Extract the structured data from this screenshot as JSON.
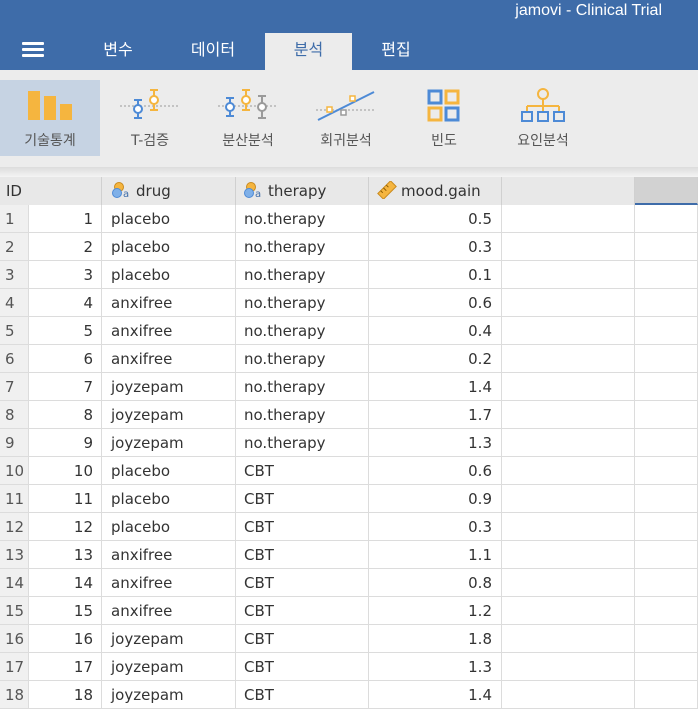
{
  "app_title": "jamovi - Clinical Trial",
  "menu": {
    "tabs": [
      {
        "label": "변수"
      },
      {
        "label": "데이터"
      },
      {
        "label": "분석"
      },
      {
        "label": "편집"
      }
    ],
    "active_tab": "분석"
  },
  "ribbon": {
    "buttons": [
      {
        "label": "기술통계",
        "icon": "bar-chart-icon"
      },
      {
        "label": "T-검증",
        "icon": "t-test-icon"
      },
      {
        "label": "분산분석",
        "icon": "anova-icon"
      },
      {
        "label": "회귀분석",
        "icon": "regression-icon"
      },
      {
        "label": "빈도",
        "icon": "frequency-grid-icon"
      },
      {
        "label": "요인분석",
        "icon": "factor-tree-icon"
      }
    ],
    "active_button": "기술통계"
  },
  "grid": {
    "headers": {
      "id": "ID",
      "drug": "drug",
      "therapy": "therapy",
      "mood_gain": "mood.gain"
    },
    "rows": [
      {
        "row": "1",
        "id": "1",
        "drug": "placebo",
        "therapy": "no.therapy",
        "mood_gain": "0.5"
      },
      {
        "row": "2",
        "id": "2",
        "drug": "placebo",
        "therapy": "no.therapy",
        "mood_gain": "0.3"
      },
      {
        "row": "3",
        "id": "3",
        "drug": "placebo",
        "therapy": "no.therapy",
        "mood_gain": "0.1"
      },
      {
        "row": "4",
        "id": "4",
        "drug": "anxifree",
        "therapy": "no.therapy",
        "mood_gain": "0.6"
      },
      {
        "row": "5",
        "id": "5",
        "drug": "anxifree",
        "therapy": "no.therapy",
        "mood_gain": "0.4"
      },
      {
        "row": "6",
        "id": "6",
        "drug": "anxifree",
        "therapy": "no.therapy",
        "mood_gain": "0.2"
      },
      {
        "row": "7",
        "id": "7",
        "drug": "joyzepam",
        "therapy": "no.therapy",
        "mood_gain": "1.4"
      },
      {
        "row": "8",
        "id": "8",
        "drug": "joyzepam",
        "therapy": "no.therapy",
        "mood_gain": "1.7"
      },
      {
        "row": "9",
        "id": "9",
        "drug": "joyzepam",
        "therapy": "no.therapy",
        "mood_gain": "1.3"
      },
      {
        "row": "10",
        "id": "10",
        "drug": "placebo",
        "therapy": "CBT",
        "mood_gain": "0.6"
      },
      {
        "row": "11",
        "id": "11",
        "drug": "placebo",
        "therapy": "CBT",
        "mood_gain": "0.9"
      },
      {
        "row": "12",
        "id": "12",
        "drug": "placebo",
        "therapy": "CBT",
        "mood_gain": "0.3"
      },
      {
        "row": "13",
        "id": "13",
        "drug": "anxifree",
        "therapy": "CBT",
        "mood_gain": "1.1"
      },
      {
        "row": "14",
        "id": "14",
        "drug": "anxifree",
        "therapy": "CBT",
        "mood_gain": "0.8"
      },
      {
        "row": "15",
        "id": "15",
        "drug": "anxifree",
        "therapy": "CBT",
        "mood_gain": "1.2"
      },
      {
        "row": "16",
        "id": "16",
        "drug": "joyzepam",
        "therapy": "CBT",
        "mood_gain": "1.8"
      },
      {
        "row": "17",
        "id": "17",
        "drug": "joyzepam",
        "therapy": "CBT",
        "mood_gain": "1.3"
      },
      {
        "row": "18",
        "id": "18",
        "drug": "joyzepam",
        "therapy": "CBT",
        "mood_gain": "1.4"
      }
    ]
  },
  "colors": {
    "brand_blue": "#3e6ca9",
    "ribbon_bg": "#ececec",
    "active_ribbon_bg": "#c6d3e3",
    "icon_orange": "#f5b53f",
    "icon_blue": "#4d8ad6",
    "icon_gray": "#9a9a9a"
  }
}
